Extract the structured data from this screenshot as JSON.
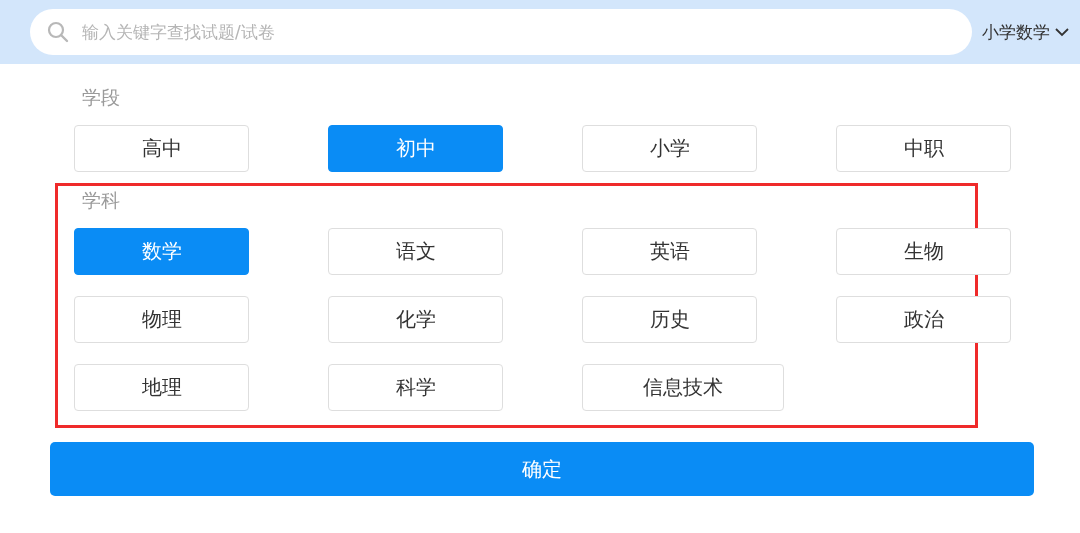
{
  "search": {
    "placeholder": "输入关键字查找试题/试卷"
  },
  "subject_dropdown": {
    "label": "小学数学"
  },
  "sections": [
    {
      "title": "学段",
      "highlighted": false,
      "options": [
        {
          "label": "高中",
          "selected": false
        },
        {
          "label": "初中",
          "selected": true
        },
        {
          "label": "小学",
          "selected": false
        },
        {
          "label": "中职",
          "selected": false
        }
      ]
    },
    {
      "title": "学科",
      "highlighted": true,
      "options": [
        {
          "label": "数学",
          "selected": true
        },
        {
          "label": "语文",
          "selected": false
        },
        {
          "label": "英语",
          "selected": false
        },
        {
          "label": "生物",
          "selected": false
        },
        {
          "label": "物理",
          "selected": false
        },
        {
          "label": "化学",
          "selected": false
        },
        {
          "label": "历史",
          "selected": false
        },
        {
          "label": "政治",
          "selected": false
        },
        {
          "label": "地理",
          "selected": false
        },
        {
          "label": "科学",
          "selected": false
        },
        {
          "label": "信息技术",
          "selected": false
        }
      ]
    }
  ],
  "confirm_button": "确定"
}
